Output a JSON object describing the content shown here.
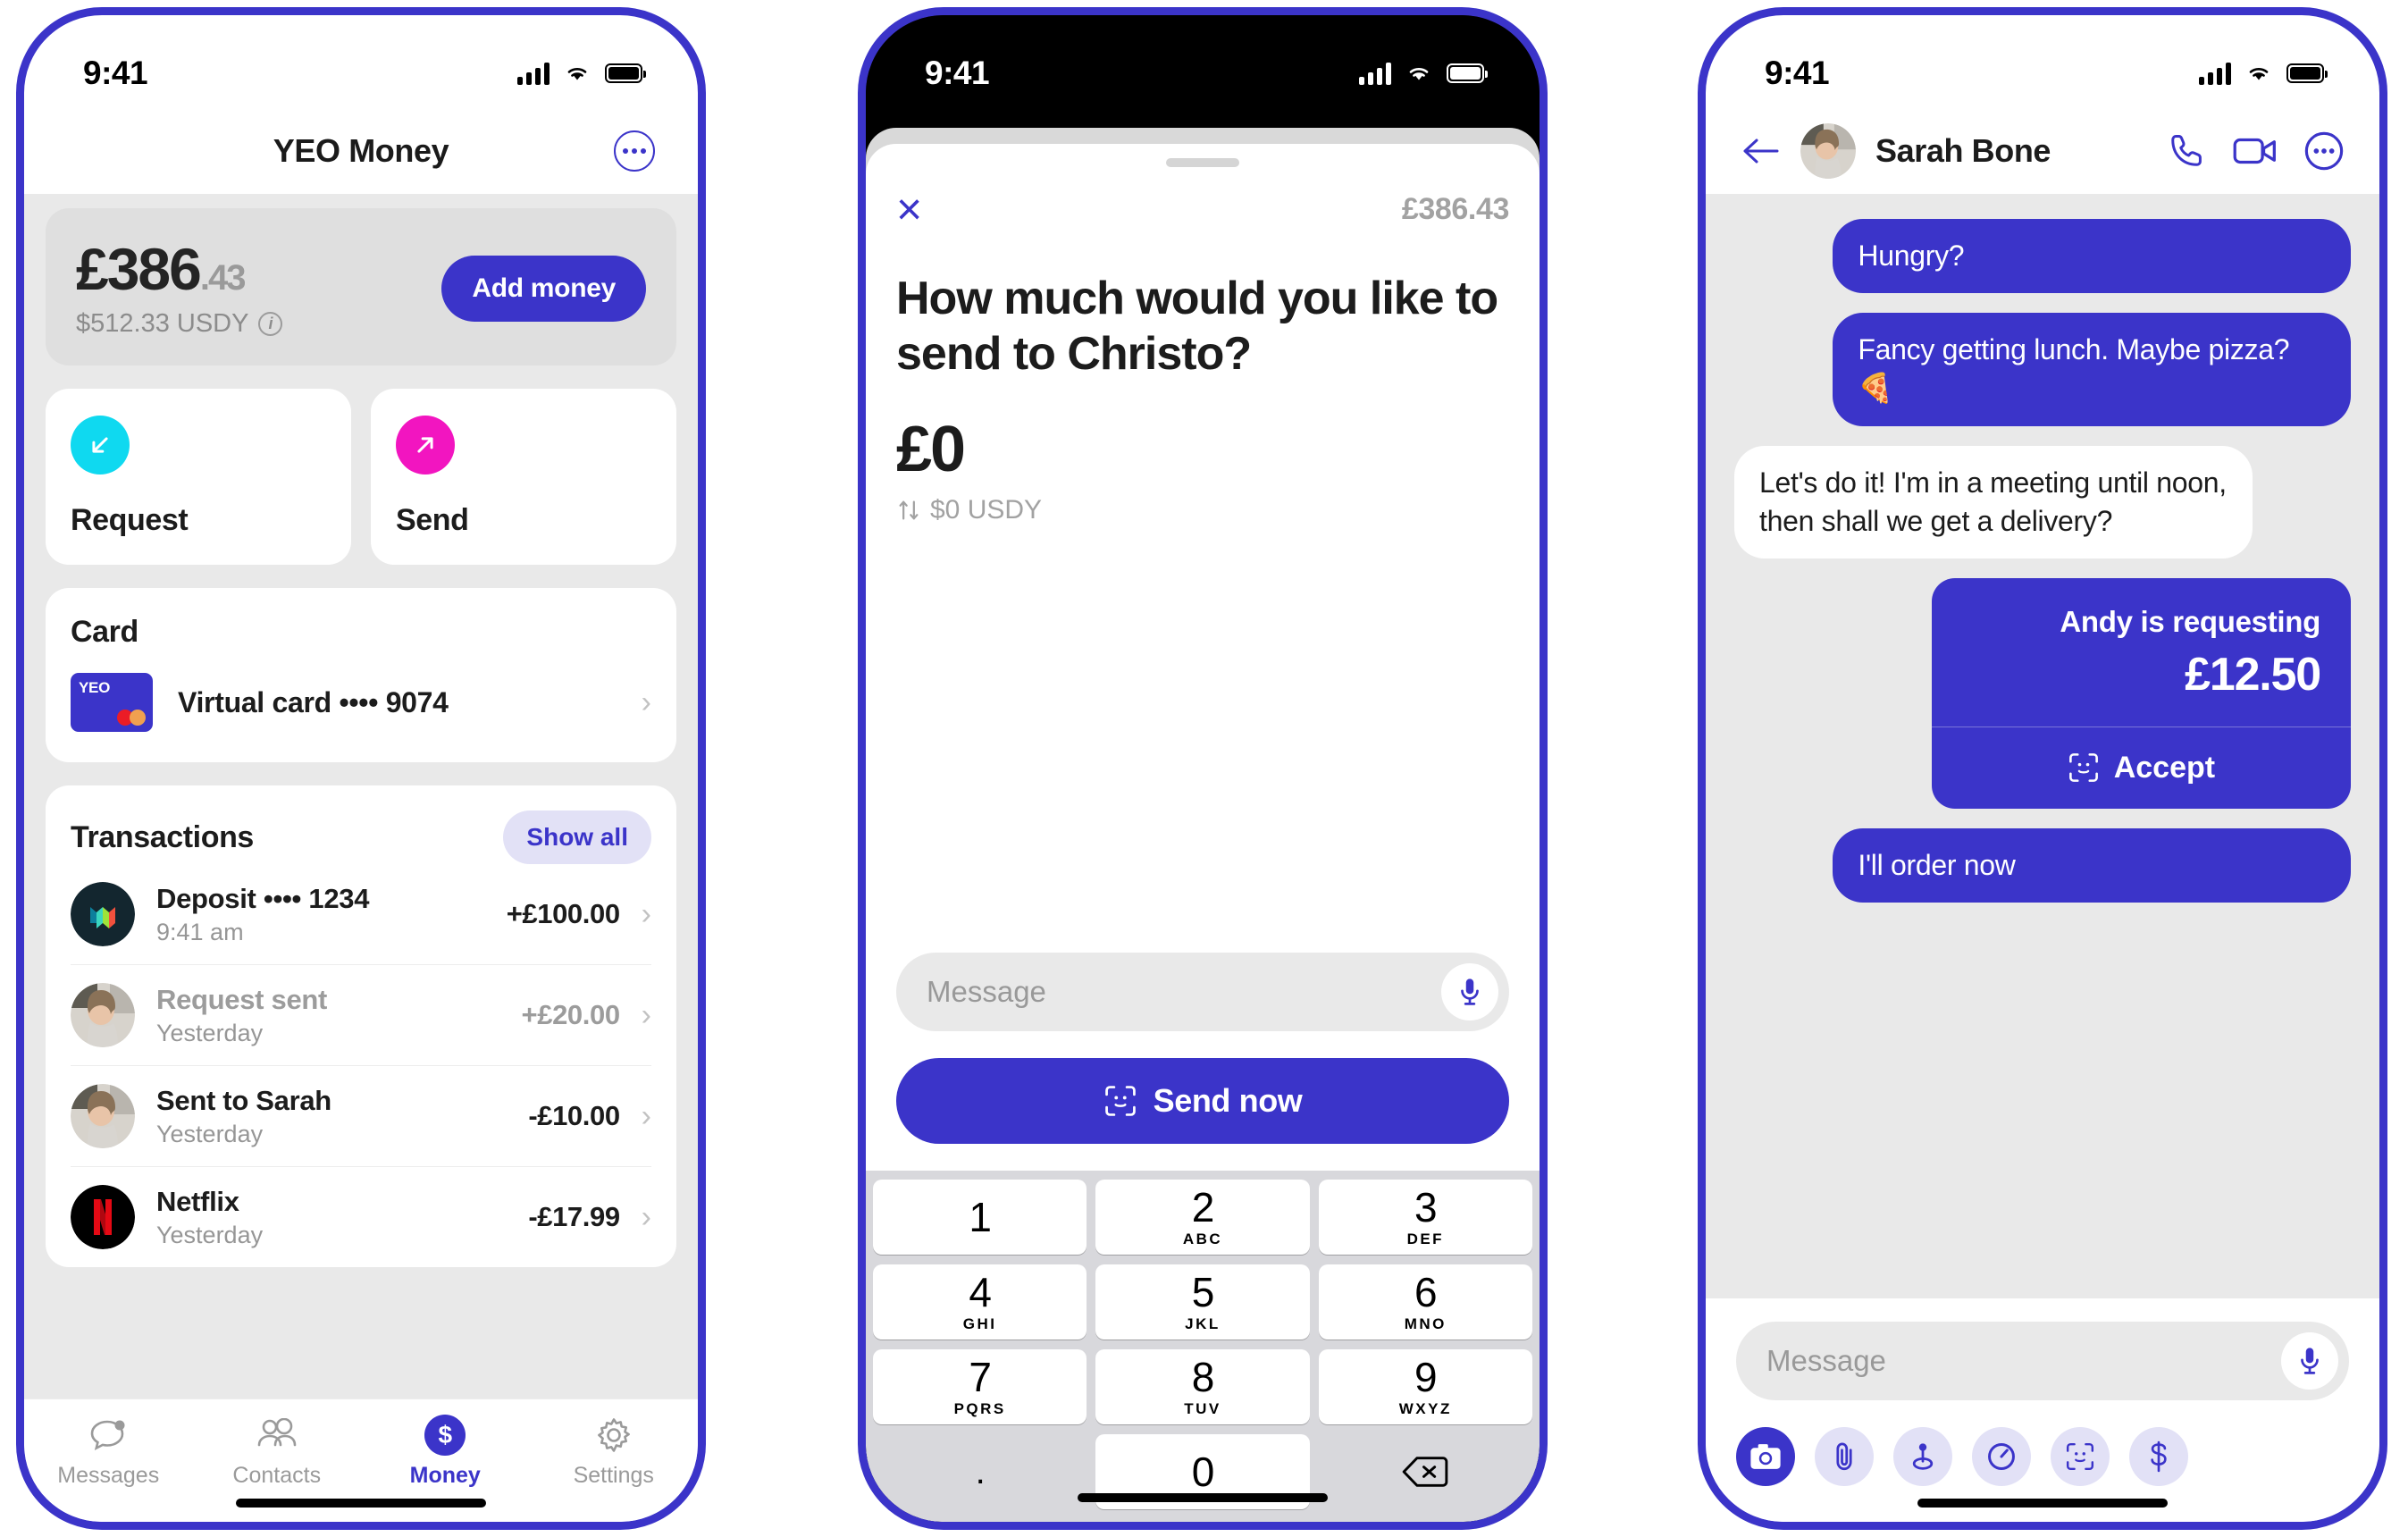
{
  "colors": {
    "brand": "#3b34c9",
    "brand_light": "#e2e1f6",
    "cyan": "#0fd9f0",
    "magenta": "#f215c0",
    "screen_bg": "#e9e9e9"
  },
  "phone1": {
    "status": {
      "time": "9:41"
    },
    "nav": {
      "title": "YEO Money",
      "more_label": "More options"
    },
    "balance": {
      "amount_major": "£386",
      "amount_minor": ".43",
      "secondary": "$512.33 USDY",
      "add_money_label": "Add money"
    },
    "actions": [
      {
        "label": "Request",
        "icon": "arrow-down-left-icon"
      },
      {
        "label": "Send",
        "icon": "arrow-up-right-icon"
      }
    ],
    "card": {
      "heading": "Card",
      "brand_mark": "YEO",
      "name": "Virtual card",
      "mask": "•••• 9074"
    },
    "transactions": {
      "heading": "Transactions",
      "show_all_label": "Show all",
      "rows": [
        {
          "name": "Deposit •••• 1234",
          "sub": "9:41 am",
          "amount": "+£100.00",
          "avatar": "monzo-logo",
          "pending": false
        },
        {
          "name": "Request sent",
          "sub": "Yesterday",
          "amount": "+£20.00",
          "avatar": "sarah-photo",
          "pending": true
        },
        {
          "name": "Sent to Sarah",
          "sub": "Yesterday",
          "amount": "-£10.00",
          "avatar": "sarah-photo",
          "pending": false
        },
        {
          "name": "Netflix",
          "sub": "Yesterday",
          "amount": "-£17.99",
          "avatar": "netflix-logo",
          "pending": false
        }
      ]
    },
    "tabs": [
      {
        "label": "Messages",
        "icon": "chat-bubble-icon",
        "active": false
      },
      {
        "label": "Contacts",
        "icon": "people-icon",
        "active": false
      },
      {
        "label": "Money",
        "icon": "dollar-icon",
        "active": true
      },
      {
        "label": "Settings",
        "icon": "gear-icon",
        "active": false
      }
    ]
  },
  "phone2": {
    "status": {
      "time": "9:41"
    },
    "close_label": "×",
    "balance": "£386.43",
    "question": "How much would you like to send to Christo?",
    "amount": "£0",
    "converted": "$0 USDY",
    "message_placeholder": "Message",
    "send_label": "Send now",
    "keypad": [
      {
        "digit": "1",
        "letters": ""
      },
      {
        "digit": "2",
        "letters": "ABC"
      },
      {
        "digit": "3",
        "letters": "DEF"
      },
      {
        "digit": "4",
        "letters": "GHI"
      },
      {
        "digit": "5",
        "letters": "JKL"
      },
      {
        "digit": "6",
        "letters": "MNO"
      },
      {
        "digit": "7",
        "letters": "PQRS"
      },
      {
        "digit": "8",
        "letters": "TUV"
      },
      {
        "digit": "9",
        "letters": "WXYZ"
      },
      {
        "digit": ".",
        "letters": ""
      },
      {
        "digit": "0",
        "letters": ""
      }
    ],
    "backspace_icon": "backspace-icon"
  },
  "phone3": {
    "status": {
      "time": "9:41"
    },
    "contact_name": "Sarah Bone",
    "header_actions": [
      {
        "icon": "phone-icon"
      },
      {
        "icon": "video-camera-icon"
      },
      {
        "icon": "more-icon"
      }
    ],
    "messages": [
      {
        "side": "out",
        "text": "Hungry?"
      },
      {
        "side": "out",
        "text": "Fancy getting lunch. Maybe pizza? 🍕"
      },
      {
        "side": "in",
        "text": "Let's do it! I'm in a meeting until noon, then shall we get a delivery?"
      }
    ],
    "request": {
      "line1": "Andy is requesting",
      "amount": "£12.50",
      "accept_label": "Accept"
    },
    "last_message": {
      "side": "out",
      "text": "I'll order now"
    },
    "message_placeholder": "Message",
    "toolbar": [
      {
        "icon": "camera-icon",
        "active": true
      },
      {
        "icon": "paperclip-icon",
        "active": false
      },
      {
        "icon": "location-pin-icon",
        "active": false
      },
      {
        "icon": "timer-icon",
        "active": false
      },
      {
        "icon": "face-id-icon",
        "active": false
      },
      {
        "icon": "dollar-icon",
        "active": false
      }
    ]
  }
}
